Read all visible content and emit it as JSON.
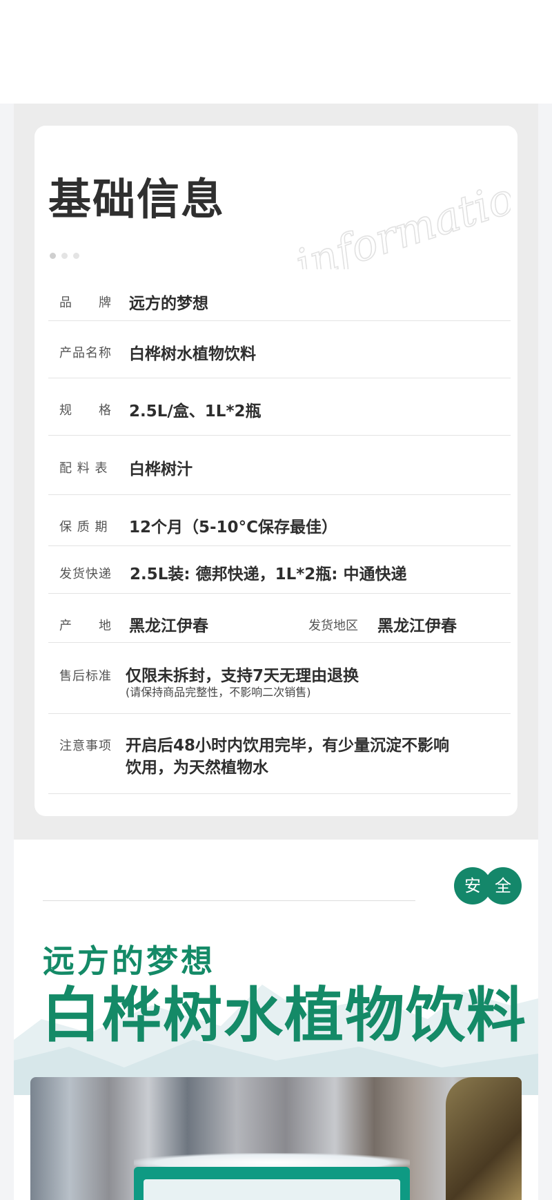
{
  "info": {
    "title": "基础信息",
    "watermark": "information",
    "rows": [
      {
        "label": "品　　牌",
        "value": "远方的梦想"
      },
      {
        "label": "产品名称",
        "value": "白桦树水植物饮料"
      },
      {
        "label": "规　　格",
        "value": "2.5L/盒、1L*2瓶"
      },
      {
        "label": "配 料 表",
        "value": "白桦树汁"
      },
      {
        "label": "保 质 期",
        "value": "12个月（5-10°C保存最佳）"
      },
      {
        "label": "发货快递",
        "value": "2.5L装: 德邦快递，1L*2瓶: 中通快递"
      },
      {
        "label": "产　　地",
        "value": "黑龙江伊春",
        "label2": "发货地区",
        "value2": "黑龙江伊春"
      },
      {
        "label": "售后标准",
        "value": "仅限未拆封，支持7天无理由退换",
        "note": "(请保持商品完整性，不影响二次销售)"
      },
      {
        "label": "注意事项",
        "value_line1": "开启后48小时内饮用完毕，有少量沉淀不影响",
        "value_line2": "饮用，为天然植物水"
      }
    ]
  },
  "brand": {
    "badge_left": "安",
    "badge_right": "全",
    "name": "远方的梦想",
    "product": "白桦树水植物饮料",
    "accent_color": "#148a67"
  }
}
